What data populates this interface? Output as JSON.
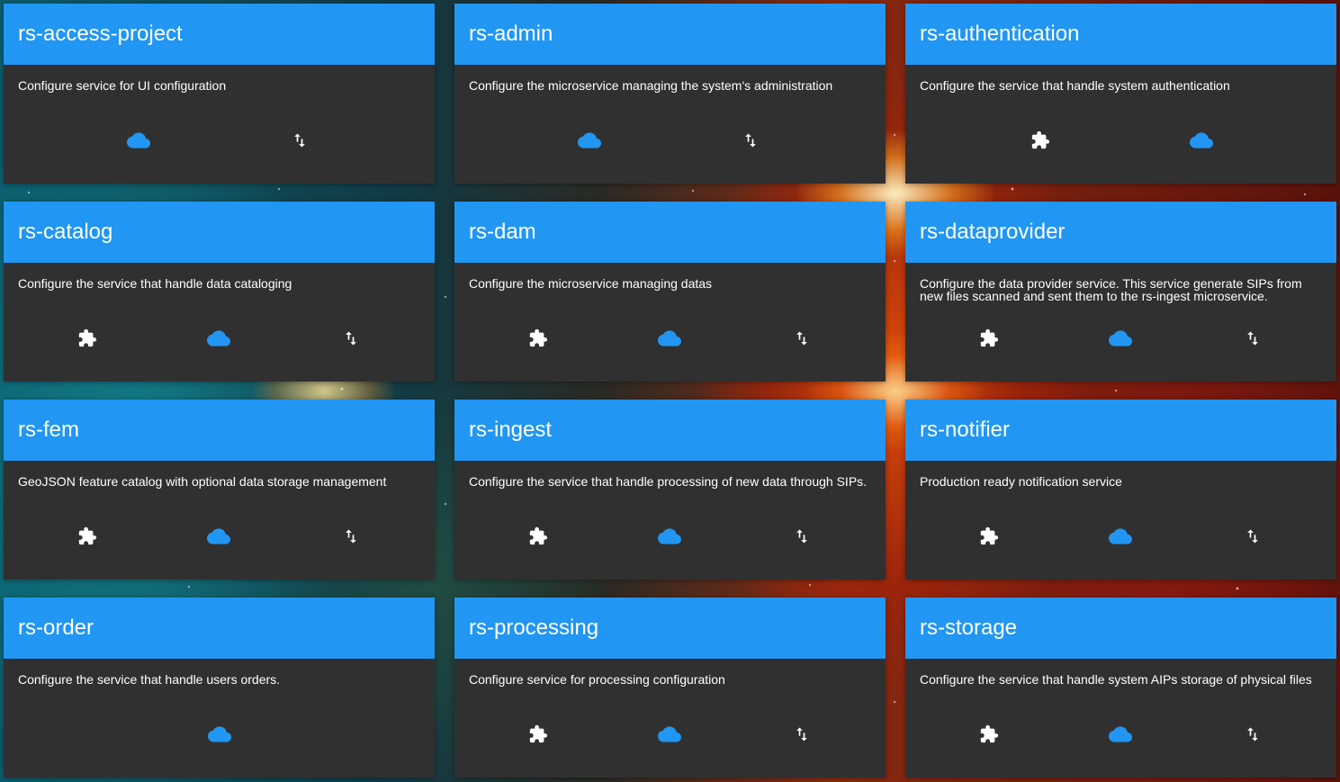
{
  "colors": {
    "header": "#2196f3",
    "card": "#303030",
    "cloud_icon": "#2196f3",
    "icon_white": "#ffffff"
  },
  "cards": [
    {
      "title": "rs-access-project",
      "description": "Configure service for UI configuration",
      "actions": [
        "cloud-icon",
        "swap-vert-icon"
      ]
    },
    {
      "title": "rs-admin",
      "description": "Configure the microservice managing the system's administration",
      "actions": [
        "cloud-icon",
        "swap-vert-icon"
      ]
    },
    {
      "title": "rs-authentication",
      "description": "Configure the service that handle system authentication",
      "actions": [
        "puzzle-icon",
        "cloud-icon"
      ]
    },
    {
      "title": "rs-catalog",
      "description": "Configure the service that handle data cataloging",
      "actions": [
        "puzzle-icon",
        "cloud-icon",
        "swap-vert-icon"
      ]
    },
    {
      "title": "rs-dam",
      "description": "Configure the microservice managing datas",
      "actions": [
        "puzzle-icon",
        "cloud-icon",
        "swap-vert-icon"
      ]
    },
    {
      "title": "rs-dataprovider",
      "description": "Configure the data provider service. This service generate SIPs from new files scanned and sent them to the rs-ingest microservice.",
      "actions": [
        "puzzle-icon",
        "cloud-icon",
        "swap-vert-icon"
      ]
    },
    {
      "title": "rs-fem",
      "description": "GeoJSON feature catalog with optional data storage management",
      "actions": [
        "puzzle-icon",
        "cloud-icon",
        "swap-vert-icon"
      ]
    },
    {
      "title": "rs-ingest",
      "description": "Configure the service that handle processing of new data through SIPs.",
      "actions": [
        "puzzle-icon",
        "cloud-icon",
        "swap-vert-icon"
      ]
    },
    {
      "title": "rs-notifier",
      "description": "Production ready notification service",
      "actions": [
        "puzzle-icon",
        "cloud-icon",
        "swap-vert-icon"
      ]
    },
    {
      "title": "rs-order",
      "description": "Configure the service that handle users orders.",
      "actions": [
        "cloud-icon"
      ]
    },
    {
      "title": "rs-processing",
      "description": "Configure service for processing configuration",
      "actions": [
        "puzzle-icon",
        "cloud-icon",
        "swap-vert-icon"
      ]
    },
    {
      "title": "rs-storage",
      "description": "Configure the service that handle system AIPs storage of physical files",
      "actions": [
        "puzzle-icon",
        "cloud-icon",
        "swap-vert-icon"
      ]
    }
  ]
}
